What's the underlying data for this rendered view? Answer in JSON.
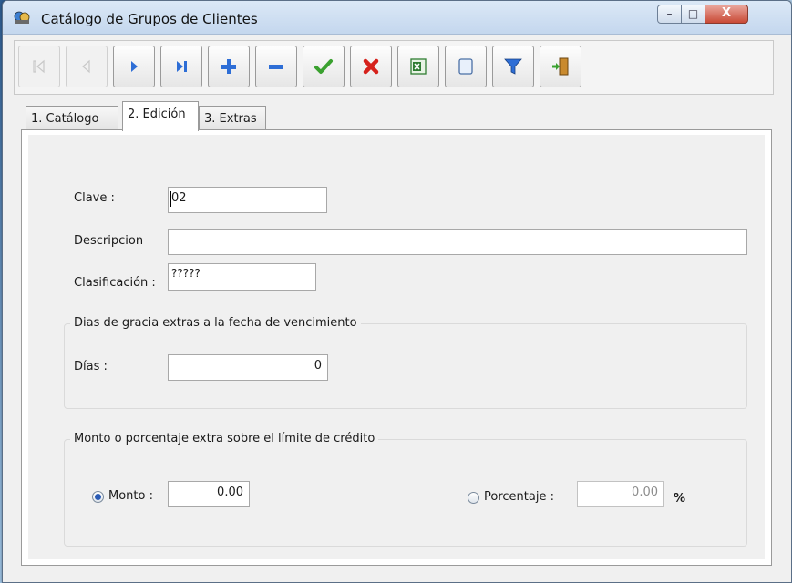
{
  "window": {
    "title": "Catálogo de Grupos de Clientes",
    "controls": {
      "minimize": "–",
      "maximize": "□",
      "close": "X"
    }
  },
  "toolbar": {
    "buttons": [
      {
        "name": "first-record",
        "icon": "skip-first-icon",
        "enabled": false
      },
      {
        "name": "previous-record",
        "icon": "play-left-icon",
        "enabled": false
      },
      {
        "name": "next-record",
        "icon": "play-right-icon",
        "enabled": true
      },
      {
        "name": "last-record",
        "icon": "skip-last-icon",
        "enabled": true
      },
      {
        "name": "add-record",
        "icon": "plus-icon",
        "enabled": true
      },
      {
        "name": "delete-record",
        "icon": "minus-icon",
        "enabled": true
      },
      {
        "name": "save-record",
        "icon": "check-icon",
        "enabled": true
      },
      {
        "name": "cancel-record",
        "icon": "x-icon",
        "enabled": true
      },
      {
        "name": "export-excel",
        "icon": "excel-icon",
        "enabled": true
      },
      {
        "name": "new-document",
        "icon": "document-icon",
        "enabled": true
      },
      {
        "name": "filter",
        "icon": "funnel-icon",
        "enabled": true
      },
      {
        "name": "exit",
        "icon": "door-exit-icon",
        "enabled": true
      }
    ],
    "colors": {
      "blue": "#2e6ed6",
      "green": "#3aa12f",
      "red": "#d6221c",
      "disabled": "#c8c8c8"
    }
  },
  "tabs": [
    {
      "label": "1. Catálogo",
      "active": false
    },
    {
      "label": "2. Edición",
      "active": true
    },
    {
      "label": "3. Extras",
      "active": false
    }
  ],
  "form": {
    "clave": {
      "label": "Clave :",
      "value": "02"
    },
    "descripcion": {
      "label": "Descripcion",
      "value": ""
    },
    "clasificacion": {
      "label": "Clasificación :",
      "value": "?????"
    },
    "dias_group": {
      "legend": "Dias de gracia extras a la fecha de vencimiento",
      "dias": {
        "label": "Días :",
        "value": "0"
      }
    },
    "monto_group": {
      "legend": "Monto o porcentaje extra sobre el límite de crédito",
      "monto": {
        "label": "Monto :",
        "value": "0.00",
        "selected": true
      },
      "porcentaje": {
        "label": "Porcentaje :",
        "value": "0.00",
        "selected": false,
        "unit": "%"
      }
    }
  }
}
